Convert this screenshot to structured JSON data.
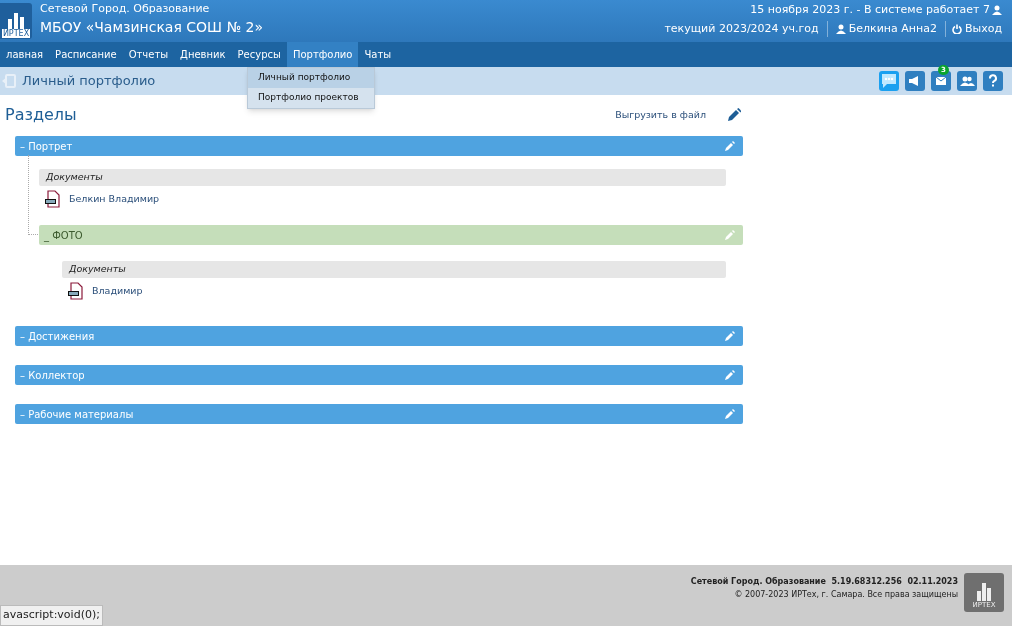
{
  "header": {
    "logo_text": "ИРТЕХ",
    "system_name": "Сетевой Город. Образование",
    "school": "МБОУ «Чамзинская СОШ № 2»",
    "date_line": "15 ноября 2023 г. - В системе работает 7",
    "year": "текущий 2023/2024 уч.год",
    "user": "Белкина Анна2",
    "logout": "Выход"
  },
  "nav": [
    {
      "label": "лавная",
      "selected": false
    },
    {
      "label": "Расписание",
      "selected": false
    },
    {
      "label": "Отчеты",
      "selected": false
    },
    {
      "label": "Дневник",
      "selected": false
    },
    {
      "label": "Ресурсы",
      "selected": false
    },
    {
      "label": "Портфолио",
      "selected": true
    },
    {
      "label": "Чаты",
      "selected": false
    }
  ],
  "dropdown": [
    {
      "label": "Личный портфолио",
      "selected": true
    },
    {
      "label": "Портфолио проектов",
      "selected": false
    }
  ],
  "page_title": "Личный портфолио",
  "toolbar": {
    "mail_badge": "3"
  },
  "content": {
    "heading": "Разделы",
    "export_link": "Выгрузить в файл",
    "sections": [
      {
        "kind": "section",
        "toggle": "–",
        "title": "Портрет",
        "items": [
          {
            "kind": "documents",
            "label": "Документы",
            "files": [
              "Белкин Владимир"
            ]
          },
          {
            "kind": "subsection",
            "toggle": "_",
            "title": "ФОТО",
            "items": [
              {
                "kind": "documents",
                "label": "Документы",
                "files": [
                  "Владимир"
                ]
              }
            ]
          }
        ]
      },
      {
        "kind": "section",
        "toggle": "–",
        "title": "Достижения"
      },
      {
        "kind": "section",
        "toggle": "–",
        "title": "Коллектор"
      },
      {
        "kind": "section",
        "toggle": "–",
        "title": "Рабочие материалы"
      }
    ]
  },
  "footer": {
    "version": "Сетевой Город. Образование  5.19.68312.256  02.11.2023",
    "copyright": "© 2007-2023 ИРТех, г. Самара. Все права защищены",
    "logo_text": "ИРТЕХ"
  },
  "status_bar": "avascript:void(0);"
}
